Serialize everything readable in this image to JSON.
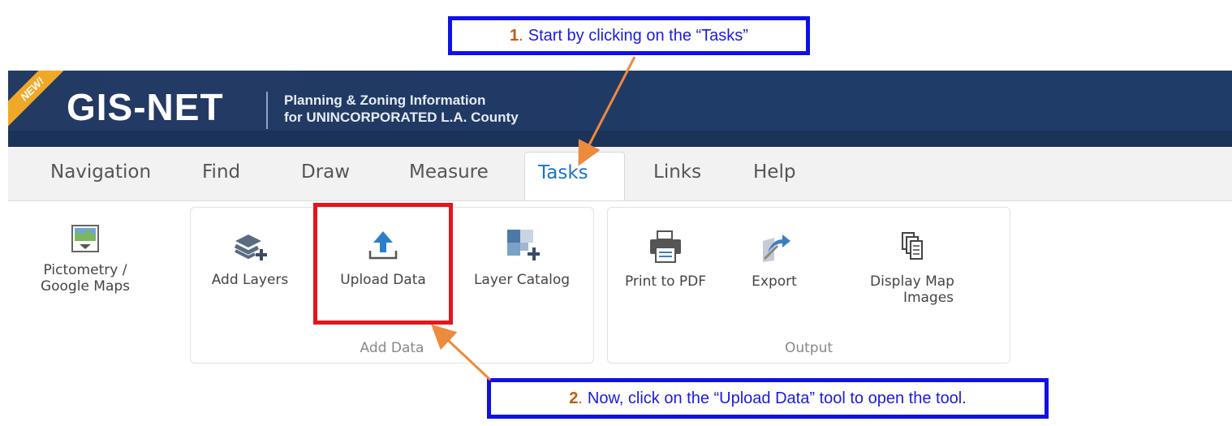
{
  "callouts": {
    "step1": {
      "number": "1",
      "text": "Start by clicking on the “Tasks”"
    },
    "step2": {
      "number": "2",
      "text": "Now, click on the “Upload Data” tool to open the tool."
    }
  },
  "header": {
    "badge": "NEW!",
    "logo": "GIS-NET",
    "subtitle_line1": "Planning & Zoning Information",
    "subtitle_line2": "for UNINCORPORATED L.A. County"
  },
  "tabs": [
    {
      "label": "Navigation"
    },
    {
      "label": "Find"
    },
    {
      "label": "Draw"
    },
    {
      "label": "Measure"
    },
    {
      "label": "Tasks",
      "active": true
    },
    {
      "label": "Links"
    },
    {
      "label": "Help"
    }
  ],
  "tools": {
    "pictometry": {
      "line1": "Pictometry /",
      "line2": "Google Maps",
      "icon": "map-icon"
    },
    "add_layers": {
      "label": "Add Layers",
      "icon": "layers-add-icon"
    },
    "upload_data": {
      "label": "Upload Data",
      "icon": "upload-icon"
    },
    "layer_catalog": {
      "label": "Layer Catalog",
      "icon": "catalog-add-icon"
    },
    "print_pdf": {
      "label": "Print to PDF",
      "icon": "printer-icon"
    },
    "export": {
      "label": "Export",
      "icon": "export-icon"
    },
    "display_map": {
      "line1": "Display Map",
      "line2": "Images",
      "icon": "copy-pages-icon"
    }
  },
  "groups": {
    "add_data": "Add Data",
    "output": "Output"
  },
  "colors": {
    "header_bg": "#233a63",
    "active_tab": "#1a73c6",
    "callout_border": "#1010e8",
    "highlight": "#e4161c",
    "arrow": "#ee8a3c"
  }
}
